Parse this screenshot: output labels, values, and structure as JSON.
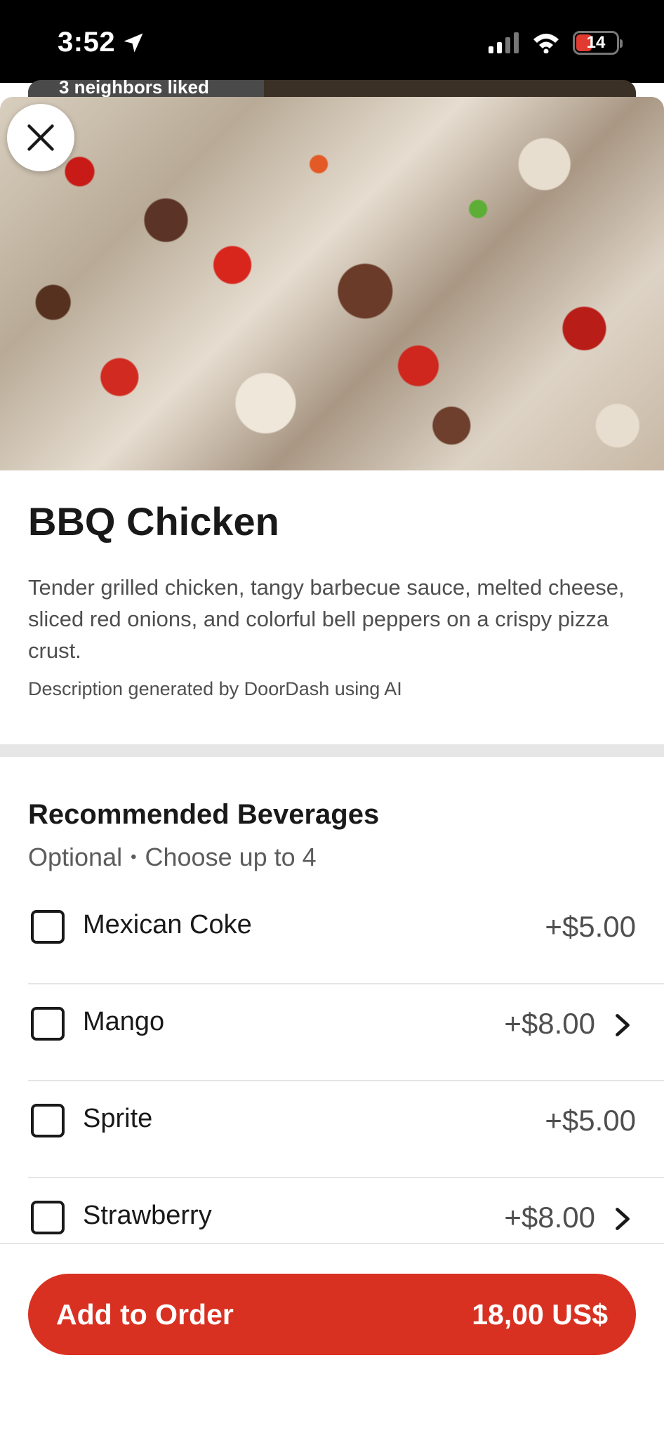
{
  "status_bar": {
    "time": "3:52",
    "battery": "14",
    "icons": [
      "location-arrow-icon",
      "cellular-signal-icon",
      "wifi-icon",
      "battery-icon"
    ]
  },
  "background": {
    "chip_text": "3 neighbors liked"
  },
  "item": {
    "title": "BBQ Chicken",
    "description": "Tender grilled chicken, tangy barbecue sauce, melted cheese, sliced red onions, and colorful bell peppers on a crispy pizza crust.",
    "ai_note": "Description generated by DoorDash using AI"
  },
  "options_group": {
    "title": "Recommended Beverages",
    "required": "Optional",
    "limit": "Choose up to 4",
    "items": [
      {
        "name": "Mexican Coke",
        "price": "+$5.00",
        "has_submenu": false
      },
      {
        "name": "Mango",
        "price": "+$8.00",
        "has_submenu": true
      },
      {
        "name": "Sprite",
        "price": "+$5.00",
        "has_submenu": false
      },
      {
        "name": "Strawberry",
        "price": "+$8.00",
        "has_submenu": true
      }
    ]
  },
  "footer": {
    "button_label": "Add to Order",
    "total": "18,00 US$"
  },
  "colors": {
    "primary": "#d93121",
    "text": "#191919",
    "secondary_text": "#4f4f4f"
  }
}
